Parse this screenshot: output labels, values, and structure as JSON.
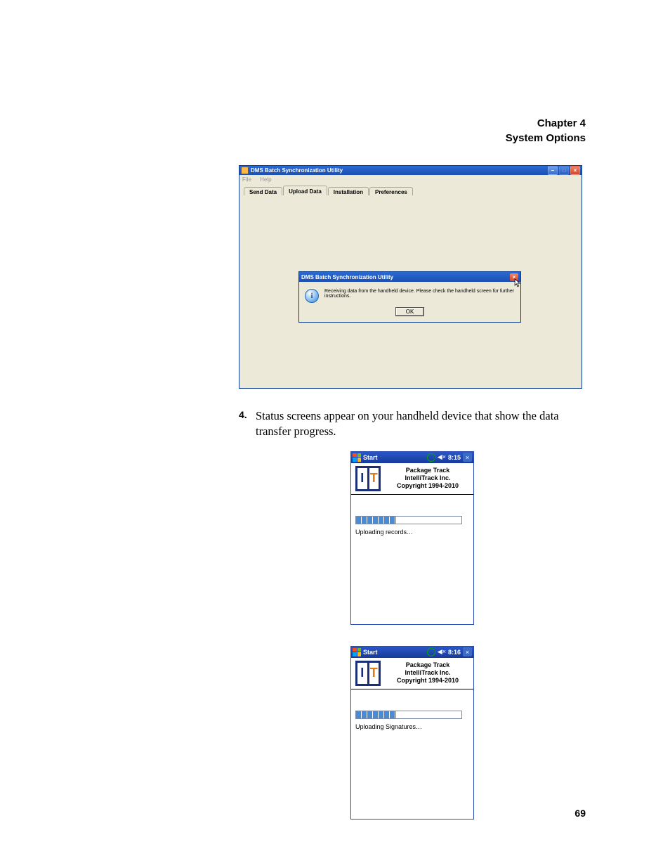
{
  "chapter": {
    "line1": "Chapter 4",
    "line2": "System Options"
  },
  "sync_window": {
    "title": "DMS Batch Synchronization Utility",
    "menus": [
      "File",
      "Help"
    ],
    "tabs": [
      "Send Data",
      "Upload Data",
      "Installation",
      "Preferences"
    ],
    "selected_tab_index": 1,
    "msgbox": {
      "title": "DMS Batch Synchronization Utility",
      "text": "Receiving data from the handheld device. Please check the handheld screen for further instructions.",
      "ok": "OK"
    }
  },
  "step": {
    "num": "4.",
    "text": "Status screens appear on your handheld device that show the data transfer progress."
  },
  "handheld_common": {
    "start": "Start",
    "product": "Package Track",
    "company": "IntelliTrack Inc.",
    "copyright": "Copyright 1994-2010",
    "speaker": "◀×"
  },
  "handheld_1": {
    "time": "8:15",
    "progress_pct": 38,
    "status": "Uploading records…"
  },
  "handheld_2": {
    "time": "8:16",
    "progress_pct": 38,
    "status": "Uploading Signatures…"
  },
  "page_number": "69"
}
